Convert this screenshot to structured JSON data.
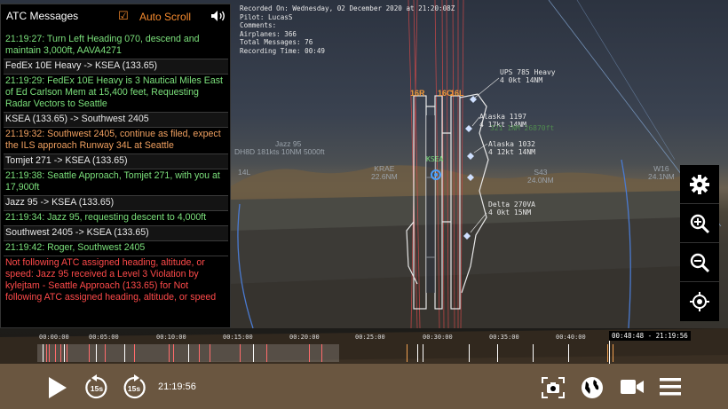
{
  "atc": {
    "title": "ATC Messages",
    "auto_scroll_label": "Auto Scroll",
    "auto_scroll_checked": true,
    "messages": [
      {
        "type": "green",
        "text": "21:19:27: Turn Left Heading 070, descend and maintain 3,000ft, AAVA4271"
      },
      {
        "type": "route",
        "text": "FedEx 10E Heavy -> KSEA (133.65)"
      },
      {
        "type": "green",
        "text": "21:19:29: FedEx 10E Heavy is 3 Nautical Miles East of Ed Carlson Mem at 15,400 feet, Requesting Radar Vectors to Seattle"
      },
      {
        "type": "route",
        "text": "KSEA (133.65) -> Southwest 2405"
      },
      {
        "type": "orange",
        "text": "21:19:32: Southwest 2405, continue as filed, expect the ILS approach Runway 34L at Seattle"
      },
      {
        "type": "route",
        "text": "Tomjet 271 -> KSEA (133.65)"
      },
      {
        "type": "green",
        "text": "21:19:38: Seattle Approach, Tomjet 271, with you at 17,900ft"
      },
      {
        "type": "route",
        "text": "Jazz 95 -> KSEA (133.65)"
      },
      {
        "type": "green",
        "text": "21:19:34: Jazz 95, requesting descent to 4,000ft"
      },
      {
        "type": "route",
        "text": "Southwest 2405 -> KSEA (133.65)"
      },
      {
        "type": "green",
        "text": "21:19:42: Roger, Southwest 2405"
      },
      {
        "type": "red",
        "text": "Not following ATC assigned heading, altitude, or speed: Jazz 95 received a Level 3 Violation by kylejtam - Seattle Approach (133.65) for Not following ATC assigned heading, altitude, or speed"
      }
    ]
  },
  "info": {
    "recorded_on": "Recorded On: Wednesday, 02 December 2020 at 21:20:08Z",
    "pilot": "Pilot: LucasS",
    "comments": "Comments:",
    "airplanes": "Airplanes: 366",
    "total_messages": "Total Messages: 76",
    "recording_time": "Recording Time: 00:49"
  },
  "map": {
    "runways": [
      "16R",
      "16C",
      "16L"
    ],
    "airport": "KSEA",
    "aircraft": [
      {
        "callsign": "UPS 785 Heavy",
        "detail": "4 0kt 14NM"
      },
      {
        "callsign": "Alaska 1197",
        "detail": "4 17kt 14NM"
      },
      {
        "callsign": "Alaska 1032",
        "detail": "4 12kt 14NM"
      },
      {
        "callsign": "Delta 270VA",
        "detail": "4 0kt 15NM"
      },
      {
        "callsign": "Jazz 95",
        "detail": "DH8D 181kts 10NM 5000ft"
      }
    ],
    "extra_label": "321 1NM 26870ft",
    "waypoints": [
      {
        "name": "14L",
        "detail": ""
      },
      {
        "name": "KRAE",
        "detail": "22.6NM"
      },
      {
        "name": "S43",
        "detail": "24.0NM"
      },
      {
        "name": "W16",
        "detail": "24.1NM"
      }
    ]
  },
  "side_controls": [
    "gear-icon",
    "zoom-in-icon",
    "zoom-out-icon",
    "locate-icon"
  ],
  "timeline": {
    "ticks": [
      "00:00:00",
      "00:05:00",
      "00:10:00",
      "00:15:00",
      "00:20:00",
      "00:25:00",
      "00:30:00",
      "00:35:00",
      "00:40:00"
    ],
    "end_badge": "00:48:48 - 21:19:56"
  },
  "controls": {
    "current_time": "21:19:56",
    "skip_back": "15s",
    "skip_forward": "15s",
    "icons": [
      "play-icon",
      "rewind-15-icon",
      "forward-15-icon",
      "screenshot-icon",
      "globe-icon",
      "camera-icon",
      "menu-icon"
    ]
  },
  "colors": {
    "accent_orange": "#f58a2e",
    "message_green": "#7be07b",
    "message_orange": "#f0a060",
    "violation_red": "#ff4a4a"
  }
}
